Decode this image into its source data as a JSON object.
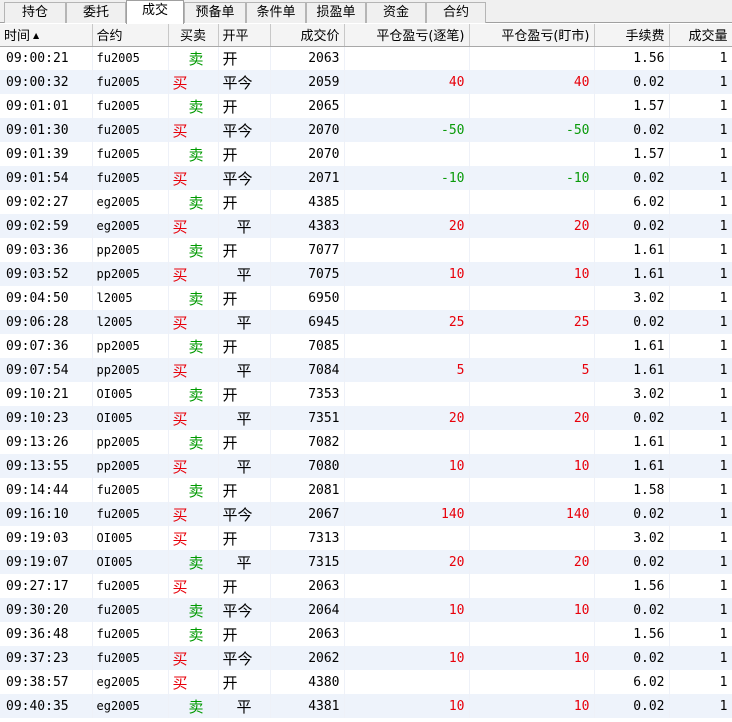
{
  "tabs": [
    {
      "label": "持仓",
      "active": false
    },
    {
      "label": "委托",
      "active": false
    },
    {
      "label": "成交",
      "active": true
    },
    {
      "label": "预备单",
      "active": false
    },
    {
      "label": "条件单",
      "active": false
    },
    {
      "label": "损盈单",
      "active": false
    },
    {
      "label": "资金",
      "active": false
    },
    {
      "label": "合约",
      "active": false
    }
  ],
  "columns": {
    "time": "时间",
    "sort_arrow": "▲",
    "contract": "合约",
    "side": "买卖",
    "open_close": "开平",
    "price": "成交价",
    "pnl_trade": "平仓盈亏(逐笔)",
    "pnl_mark": "平仓盈亏(盯市)",
    "fee": "手续费",
    "qty": "成交量"
  },
  "colors": {
    "buy": "#e8000a",
    "sell": "#009a00",
    "row_alt": "#eef3fb"
  },
  "trades": [
    {
      "time": "09:00:21",
      "contract": "fu2005",
      "side": "卖",
      "oc": "开",
      "price": "2063",
      "pnl_trade": "",
      "pnl_mark": "",
      "fee": "1.56",
      "qty": "1"
    },
    {
      "time": "09:00:32",
      "contract": "fu2005",
      "side": "买",
      "oc": "平今",
      "price": "2059",
      "pnl_trade": "40",
      "pnl_mark": "40",
      "fee": "0.02",
      "qty": "1"
    },
    {
      "time": "09:01:01",
      "contract": "fu2005",
      "side": "卖",
      "oc": "开",
      "price": "2065",
      "pnl_trade": "",
      "pnl_mark": "",
      "fee": "1.57",
      "qty": "1"
    },
    {
      "time": "09:01:30",
      "contract": "fu2005",
      "side": "买",
      "oc": "平今",
      "price": "2070",
      "pnl_trade": "-50",
      "pnl_mark": "-50",
      "fee": "0.02",
      "qty": "1"
    },
    {
      "time": "09:01:39",
      "contract": "fu2005",
      "side": "卖",
      "oc": "开",
      "price": "2070",
      "pnl_trade": "",
      "pnl_mark": "",
      "fee": "1.57",
      "qty": "1"
    },
    {
      "time": "09:01:54",
      "contract": "fu2005",
      "side": "买",
      "oc": "平今",
      "price": "2071",
      "pnl_trade": "-10",
      "pnl_mark": "-10",
      "fee": "0.02",
      "qty": "1"
    },
    {
      "time": "09:02:27",
      "contract": "eg2005",
      "side": "卖",
      "oc": "开",
      "price": "4385",
      "pnl_trade": "",
      "pnl_mark": "",
      "fee": "6.02",
      "qty": "1"
    },
    {
      "time": "09:02:59",
      "contract": "eg2005",
      "side": "买",
      "oc": "平",
      "price": "4383",
      "pnl_trade": "20",
      "pnl_mark": "20",
      "fee": "0.02",
      "qty": "1"
    },
    {
      "time": "09:03:36",
      "contract": "pp2005",
      "side": "卖",
      "oc": "开",
      "price": "7077",
      "pnl_trade": "",
      "pnl_mark": "",
      "fee": "1.61",
      "qty": "1"
    },
    {
      "time": "09:03:52",
      "contract": "pp2005",
      "side": "买",
      "oc": "平",
      "price": "7075",
      "pnl_trade": "10",
      "pnl_mark": "10",
      "fee": "1.61",
      "qty": "1"
    },
    {
      "time": "09:04:50",
      "contract": "l2005",
      "side": "卖",
      "oc": "开",
      "price": "6950",
      "pnl_trade": "",
      "pnl_mark": "",
      "fee": "3.02",
      "qty": "1"
    },
    {
      "time": "09:06:28",
      "contract": "l2005",
      "side": "买",
      "oc": "平",
      "price": "6945",
      "pnl_trade": "25",
      "pnl_mark": "25",
      "fee": "0.02",
      "qty": "1"
    },
    {
      "time": "09:07:36",
      "contract": "pp2005",
      "side": "卖",
      "oc": "开",
      "price": "7085",
      "pnl_trade": "",
      "pnl_mark": "",
      "fee": "1.61",
      "qty": "1"
    },
    {
      "time": "09:07:54",
      "contract": "pp2005",
      "side": "买",
      "oc": "平",
      "price": "7084",
      "pnl_trade": "5",
      "pnl_mark": "5",
      "fee": "1.61",
      "qty": "1"
    },
    {
      "time": "09:10:21",
      "contract": "OI005",
      "side": "卖",
      "oc": "开",
      "price": "7353",
      "pnl_trade": "",
      "pnl_mark": "",
      "fee": "3.02",
      "qty": "1"
    },
    {
      "time": "09:10:23",
      "contract": "OI005",
      "side": "买",
      "oc": "平",
      "price": "7351",
      "pnl_trade": "20",
      "pnl_mark": "20",
      "fee": "0.02",
      "qty": "1"
    },
    {
      "time": "09:13:26",
      "contract": "pp2005",
      "side": "卖",
      "oc": "开",
      "price": "7082",
      "pnl_trade": "",
      "pnl_mark": "",
      "fee": "1.61",
      "qty": "1"
    },
    {
      "time": "09:13:55",
      "contract": "pp2005",
      "side": "买",
      "oc": "平",
      "price": "7080",
      "pnl_trade": "10",
      "pnl_mark": "10",
      "fee": "1.61",
      "qty": "1"
    },
    {
      "time": "09:14:44",
      "contract": "fu2005",
      "side": "卖",
      "oc": "开",
      "price": "2081",
      "pnl_trade": "",
      "pnl_mark": "",
      "fee": "1.58",
      "qty": "1"
    },
    {
      "time": "09:16:10",
      "contract": "fu2005",
      "side": "买",
      "oc": "平今",
      "price": "2067",
      "pnl_trade": "140",
      "pnl_mark": "140",
      "fee": "0.02",
      "qty": "1"
    },
    {
      "time": "09:19:03",
      "contract": "OI005",
      "side": "买",
      "oc": "开",
      "price": "7313",
      "pnl_trade": "",
      "pnl_mark": "",
      "fee": "3.02",
      "qty": "1"
    },
    {
      "time": "09:19:07",
      "contract": "OI005",
      "side": "卖",
      "oc": "平",
      "price": "7315",
      "pnl_trade": "20",
      "pnl_mark": "20",
      "fee": "0.02",
      "qty": "1"
    },
    {
      "time": "09:27:17",
      "contract": "fu2005",
      "side": "买",
      "oc": "开",
      "price": "2063",
      "pnl_trade": "",
      "pnl_mark": "",
      "fee": "1.56",
      "qty": "1"
    },
    {
      "time": "09:30:20",
      "contract": "fu2005",
      "side": "卖",
      "oc": "平今",
      "price": "2064",
      "pnl_trade": "10",
      "pnl_mark": "10",
      "fee": "0.02",
      "qty": "1"
    },
    {
      "time": "09:36:48",
      "contract": "fu2005",
      "side": "卖",
      "oc": "开",
      "price": "2063",
      "pnl_trade": "",
      "pnl_mark": "",
      "fee": "1.56",
      "qty": "1"
    },
    {
      "time": "09:37:23",
      "contract": "fu2005",
      "side": "买",
      "oc": "平今",
      "price": "2062",
      "pnl_trade": "10",
      "pnl_mark": "10",
      "fee": "0.02",
      "qty": "1"
    },
    {
      "time": "09:38:57",
      "contract": "eg2005",
      "side": "买",
      "oc": "开",
      "price": "4380",
      "pnl_trade": "",
      "pnl_mark": "",
      "fee": "6.02",
      "qty": "1"
    },
    {
      "time": "09:40:35",
      "contract": "eg2005",
      "side": "卖",
      "oc": "平",
      "price": "4381",
      "pnl_trade": "10",
      "pnl_mark": "10",
      "fee": "0.02",
      "qty": "1"
    }
  ]
}
